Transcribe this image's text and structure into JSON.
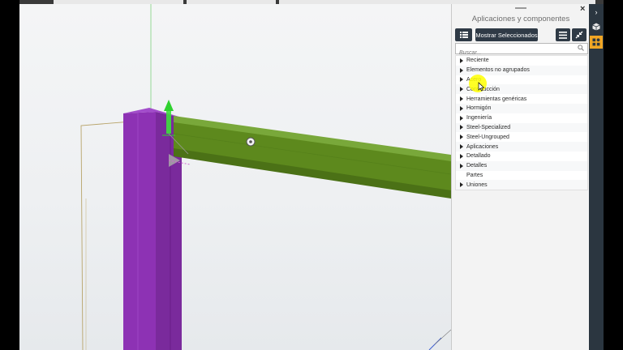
{
  "panel": {
    "title": "Aplicaciones y componentes",
    "close_label": "×",
    "show_selected_label": "Mostrar Seleccionados",
    "search_placeholder": "Buscar...",
    "items": [
      {
        "label": "Reciente",
        "expandable": true
      },
      {
        "label": "Elementos no agrupados",
        "expandable": true
      },
      {
        "label": "Acero",
        "expandable": true
      },
      {
        "label": "Construcción",
        "expandable": true
      },
      {
        "label": "Herramientas genéricas",
        "expandable": true
      },
      {
        "label": "Hormigón",
        "expandable": true
      },
      {
        "label": "Ingeniería",
        "expandable": true
      },
      {
        "label": "Steel-Specialized",
        "expandable": true
      },
      {
        "label": "Steel-Ungrouped",
        "expandable": true
      },
      {
        "label": "Aplicaciones",
        "expandable": true
      },
      {
        "label": "Detallado",
        "expandable": true
      },
      {
        "label": "Detalles",
        "expandable": true
      },
      {
        "label": "Partes",
        "expandable": false
      },
      {
        "label": "Uniones",
        "expandable": true
      }
    ]
  },
  "colors": {
    "column": "#8b2fb0",
    "beam": "#5f8a1f",
    "toolbar_dark": "#2f3a46",
    "accent": "#f1a624"
  },
  "icons": {
    "list": "list-icon",
    "menu": "hamburger-icon",
    "collapse": "collapse-arrows-icon",
    "search": "search-icon",
    "chevron": "chevron-right-icon",
    "cube": "cube-icon",
    "apps": "applications-icon"
  }
}
